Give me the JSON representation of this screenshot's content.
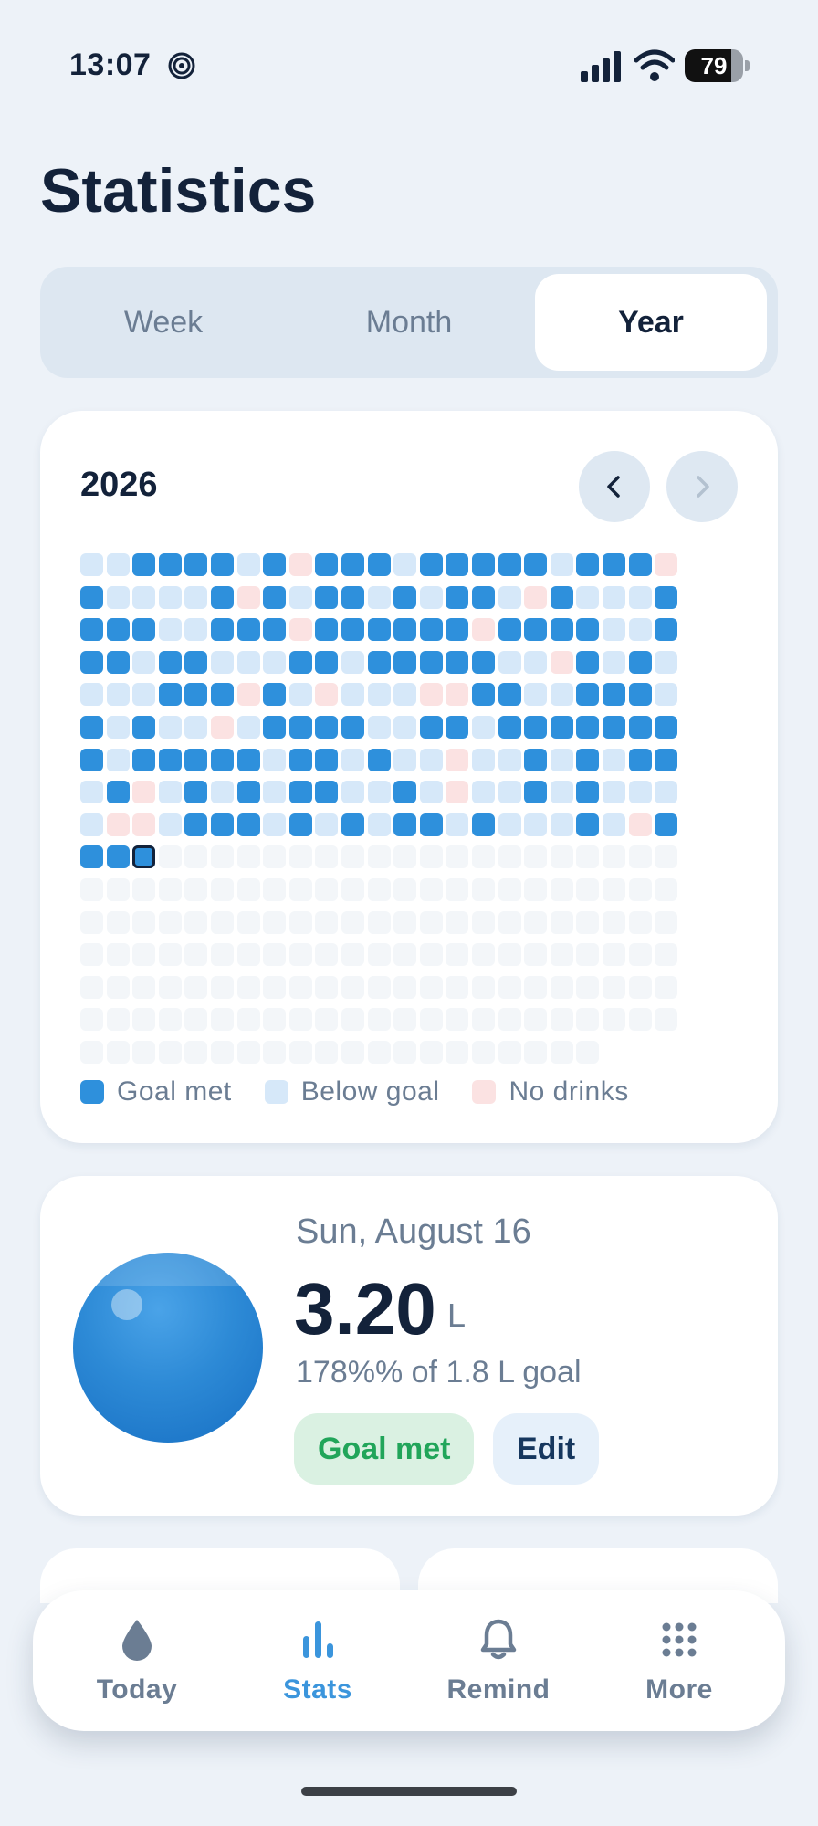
{
  "status_bar": {
    "time": "13:07",
    "battery": "79",
    "battery_level": 0.79,
    "icons": [
      "focus-spiral-icon",
      "cellular-signal-icon",
      "wifi-icon",
      "battery-icon"
    ]
  },
  "header": {
    "title": "Statistics"
  },
  "segments": {
    "options": [
      "Week",
      "Month",
      "Year"
    ],
    "selected": "Year"
  },
  "year_card": {
    "year": "2026",
    "prev_icon": "chevron-left-icon",
    "next_icon": "chevron-right-icon",
    "next_enabled": false,
    "heatmap": {
      "rows": [
        "BBGGGGBGNGGGBGGGGGBGGGN",
        "GBBBBGNGBGGBGBGGBNGBBBG",
        "GGGBBGGGNGGGGGGNGGGGBBG",
        "GGBGGBBBGGBGGGGGBBNGBGB",
        "BBBGGGNGBNBBBNNGGBBGGGB",
        "GBGBBNBGGGGBBGGBGGGGGGG",
        "GBGGGGGBGGBGBBNBBGBGBGG",
        "BGNBGBGBGGBBGBNBBGBGBBB",
        "BNNBGGGBGBGBGGBGBBBGBNG",
        "GGg...................."
      ],
      "legend_codes": {
        "G": "Goal met",
        "B": "Below goal",
        "N": "No drinks",
        "g": "Selected day (goal met)",
        ".": "Future day"
      },
      "selected_day": "Sun, August 16"
    },
    "legend": [
      {
        "label": "Goal met",
        "color": "#2e90dc"
      },
      {
        "label": "Below goal",
        "color": "#d6e8f9"
      },
      {
        "label": "No drinks",
        "color": "#fbe2e2"
      }
    ]
  },
  "day_detail": {
    "date": "Sun, August 16",
    "amount": "3.20",
    "unit": "L",
    "percent_text": "178%% of 1.8 L goal",
    "status_badge": "Goal met",
    "edit_label": "Edit"
  },
  "tab_bar": {
    "items": [
      {
        "label": "Today",
        "icon": "water-drop-icon"
      },
      {
        "label": "Stats",
        "icon": "bar-chart-icon"
      },
      {
        "label": "Remind",
        "icon": "bell-icon"
      },
      {
        "label": "More",
        "icon": "grid-dots-icon"
      }
    ],
    "active": "Stats"
  },
  "colors": {
    "accent": "#3b95dc",
    "goal_met": "#2e90dc",
    "below_goal": "#d6e8f9",
    "no_drinks": "#fbe2e2",
    "future_day": "#f3f6f9",
    "success_text": "#21a55a"
  }
}
